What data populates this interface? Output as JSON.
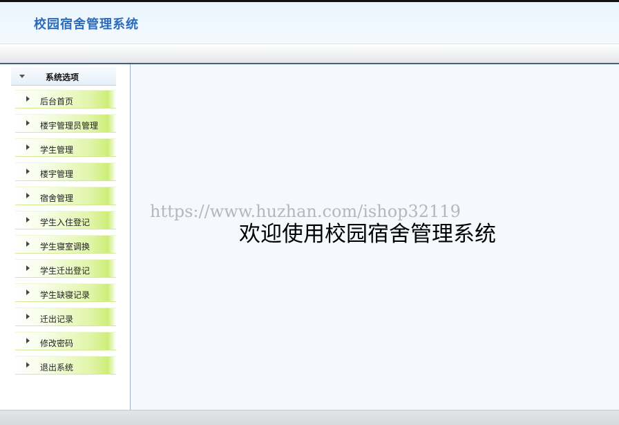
{
  "app": {
    "title": "校园宿舍管理系统"
  },
  "sidebar": {
    "heading": "系统选项",
    "items": [
      {
        "label": "后台首页"
      },
      {
        "label": "楼宇管理员管理"
      },
      {
        "label": "学生管理"
      },
      {
        "label": "楼宇管理"
      },
      {
        "label": "宿舍管理"
      },
      {
        "label": "学生入住登记"
      },
      {
        "label": "学生寝室调换"
      },
      {
        "label": "学生迁出登记"
      },
      {
        "label": "学生缺寝记录"
      },
      {
        "label": "迁出记录"
      },
      {
        "label": "修改密码"
      },
      {
        "label": "退出系统"
      }
    ]
  },
  "main": {
    "welcome": "欢迎使用校园宿舍管理系统",
    "watermark": "https://www.huzhan.com/ishop32119"
  },
  "colors": {
    "title": "#2a6bbf",
    "menu_gradient_end": "#cdee78",
    "content_bg": "#f5f9fe"
  }
}
